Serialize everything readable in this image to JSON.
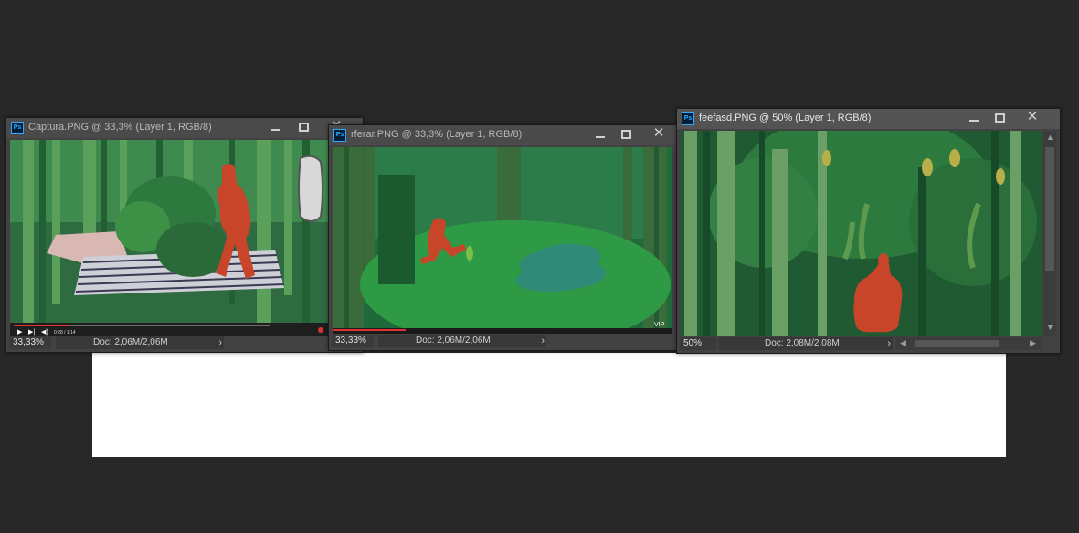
{
  "windows": [
    {
      "title": "Captura.PNG @ 33,3% (Layer 1, RGB/8)",
      "zoom": "33,33%",
      "doc": "Doc: 2,06M/2,06M"
    },
    {
      "title": "rferar.PNG @ 33,3% (Layer 1, RGB/8)",
      "zoom": "33,33%",
      "doc": "Doc: 2,06M/2,06M"
    },
    {
      "title": "feefasd.PNG @ 50% (Layer 1, RGB/8)",
      "zoom": "50%",
      "doc": "Doc: 2,08M/2,08M"
    }
  ],
  "labels": {
    "app_icon": "Ps",
    "video_timecode": "0:28 / 1:14",
    "watermark": "VIP"
  },
  "icons": [
    "ps-app-icon",
    "minimize-icon",
    "maximize-icon",
    "close-icon",
    "chevron-right-icon",
    "chevron-left-icon",
    "chevron-up-icon",
    "chevron-down-icon",
    "play-icon",
    "next-icon",
    "volume-icon"
  ],
  "colors": {
    "workspace": "#282828",
    "panel": "#424242",
    "titlebar": "#535353",
    "ps_blue": "#31a8ff",
    "figure_red": "#c8452a"
  }
}
